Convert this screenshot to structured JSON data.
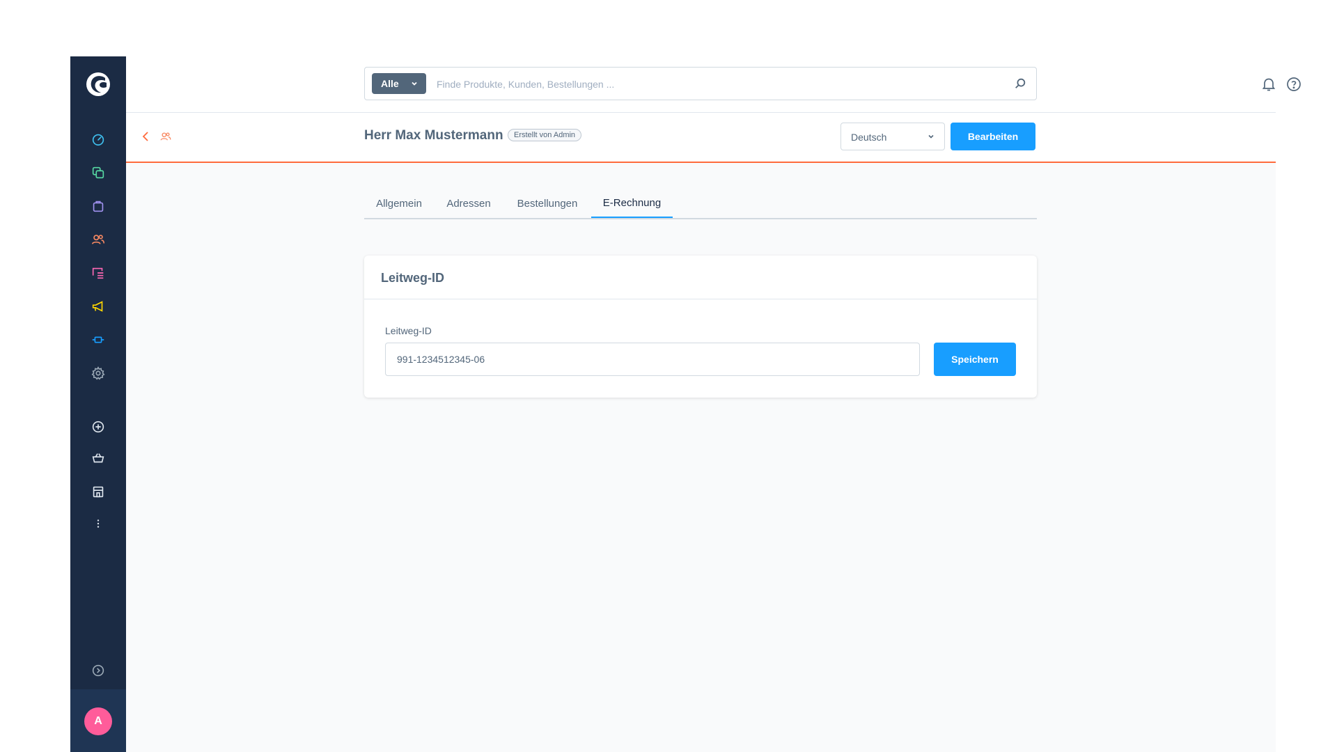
{
  "search": {
    "type_label": "Alle",
    "placeholder": "Finde Produkte, Kunden, Bestellungen ..."
  },
  "sidebar": {
    "items": [
      {
        "icon": "dashboard-icon",
        "color": "#57d9a3"
      },
      {
        "icon": "catalog-icon",
        "color": "#57d9a3"
      },
      {
        "icon": "orders-icon",
        "color": "#a092f0"
      },
      {
        "icon": "customers-icon",
        "color": "#f88962"
      },
      {
        "icon": "content-icon",
        "color": "#ff68b4"
      },
      {
        "icon": "marketing-icon",
        "color": "#ffd700"
      },
      {
        "icon": "extensions-icon",
        "color": "#189eff"
      },
      {
        "icon": "settings-icon",
        "color": "#9aa8b5"
      }
    ],
    "avatar_initial": "A"
  },
  "smartbar": {
    "title": "Herr Max Mustermann",
    "badge": "Erstellt von Admin",
    "language": "Deutsch",
    "edit_label": "Bearbeiten"
  },
  "tabs": [
    {
      "label": "Allgemein"
    },
    {
      "label": "Adressen"
    },
    {
      "label": "Bestellungen"
    },
    {
      "label": "E-Rechnung",
      "active": true
    }
  ],
  "card": {
    "title": "Leitweg-ID",
    "field_label": "Leitweg-ID",
    "field_value": "991-1234512345-06",
    "save_label": "Speichern"
  },
  "colors": {
    "sidebar_bg": "#1b2b44",
    "primary": "#189eff",
    "accent_customers": "#ff6a3c",
    "avatar": "#ff5c9a"
  }
}
